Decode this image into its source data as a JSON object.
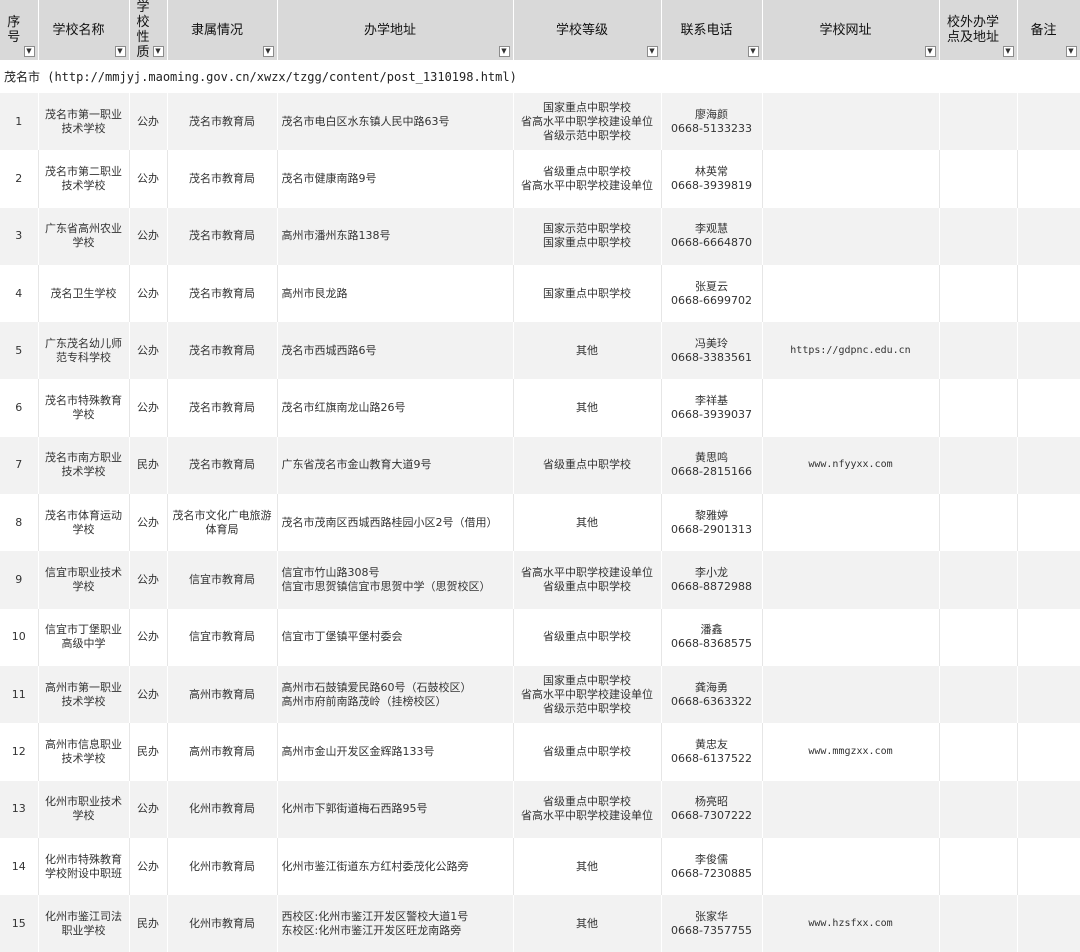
{
  "headers": {
    "no": "序号",
    "name": "学校名称",
    "nature": "学校性质",
    "affiliation": "隶属情况",
    "address": "办学地址",
    "grade": "学校等级",
    "contact": "联系电话",
    "website": "学校网址",
    "offsite": "校外办学点及地址",
    "remark": "备注",
    "dropdown_icon": "▼"
  },
  "group_title": "茂名市 (http://mmjyj.maoming.gov.cn/xwzx/tzgg/content/post_1310198.html)",
  "rows": [
    {
      "no": "1",
      "name": "茂名市第一职业技术学校",
      "nature": "公办",
      "affiliation": "茂名市教育局",
      "address": [
        "茂名市电白区水东镇人民中路63号"
      ],
      "grade": [
        "国家重点中职学校",
        "省高水平中职学校建设单位",
        "省级示范中职学校"
      ],
      "contact_name": "廖海颜",
      "contact_phone": "0668-5133233",
      "website": "",
      "offsite": "",
      "remark": ""
    },
    {
      "no": "2",
      "name": "茂名市第二职业技术学校",
      "nature": "公办",
      "affiliation": "茂名市教育局",
      "address": [
        "茂名市健康南路9号"
      ],
      "grade": [
        "省级重点中职学校",
        "省高水平中职学校建设单位"
      ],
      "contact_name": "林英常",
      "contact_phone": "0668-3939819",
      "website": "",
      "offsite": "",
      "remark": ""
    },
    {
      "no": "3",
      "name": "广东省高州农业学校",
      "nature": "公办",
      "affiliation": "茂名市教育局",
      "address": [
        "高州市潘州东路138号"
      ],
      "grade": [
        "国家示范中职学校",
        "国家重点中职学校"
      ],
      "contact_name": "李观慧",
      "contact_phone": "0668-6664870",
      "website": "",
      "offsite": "",
      "remark": ""
    },
    {
      "no": "4",
      "name": "茂名卫生学校",
      "nature": "公办",
      "affiliation": "茂名市教育局",
      "address": [
        "高州市艮龙路"
      ],
      "grade": [
        "国家重点中职学校"
      ],
      "contact_name": "张夏云",
      "contact_phone": "0668-6699702",
      "website": "",
      "offsite": "",
      "remark": ""
    },
    {
      "no": "5",
      "name": "广东茂名幼儿师范专科学校",
      "nature": "公办",
      "affiliation": "茂名市教育局",
      "address": [
        "茂名市西城西路6号"
      ],
      "grade": [
        "其他"
      ],
      "contact_name": "冯美玲",
      "contact_phone": "0668-3383561",
      "website": "https://gdpnc.edu.cn",
      "offsite": "",
      "remark": ""
    },
    {
      "no": "6",
      "name": "茂名市特殊教育学校",
      "nature": "公办",
      "affiliation": "茂名市教育局",
      "address": [
        "茂名市红旗南龙山路26号"
      ],
      "grade": [
        "其他"
      ],
      "contact_name": "李祥基",
      "contact_phone": "0668-3939037",
      "website": "",
      "offsite": "",
      "remark": ""
    },
    {
      "no": "7",
      "name": "茂名市南方职业技术学校",
      "nature": "民办",
      "affiliation": "茂名市教育局",
      "address": [
        "广东省茂名市金山教育大道9号"
      ],
      "grade": [
        "省级重点中职学校"
      ],
      "contact_name": "黄思鸣",
      "contact_phone": "0668-2815166",
      "website": "www.nfyyxx.com",
      "offsite": "",
      "remark": ""
    },
    {
      "no": "8",
      "name": "茂名市体育运动学校",
      "nature": "公办",
      "affiliation": "茂名市文化广电旅游体育局",
      "address": [
        "茂名市茂南区西城西路桂园小区2号（借用）"
      ],
      "grade": [
        "其他"
      ],
      "contact_name": "黎雅婷",
      "contact_phone": "0668-2901313",
      "website": "",
      "offsite": "",
      "remark": ""
    },
    {
      "no": "9",
      "name": "信宜市职业技术学校",
      "nature": "公办",
      "affiliation": "信宜市教育局",
      "address": [
        "信宜市竹山路308号",
        "信宜市思贺镇信宜市思贺中学（思贺校区）"
      ],
      "grade": [
        "省高水平中职学校建设单位",
        "省级重点中职学校"
      ],
      "contact_name": "李小龙",
      "contact_phone": "0668-8872988",
      "website": "",
      "offsite": "",
      "remark": ""
    },
    {
      "no": "10",
      "name": "信宜市丁堡职业高级中学",
      "nature": "公办",
      "affiliation": "信宜市教育局",
      "address": [
        "信宜市丁堡镇平堡村委会"
      ],
      "grade": [
        "省级重点中职学校"
      ],
      "contact_name": "潘鑫",
      "contact_phone": "0668-8368575",
      "website": "",
      "offsite": "",
      "remark": ""
    },
    {
      "no": "11",
      "name": "高州市第一职业技术学校",
      "nature": "公办",
      "affiliation": "高州市教育局",
      "address": [
        "高州市石鼓镇爱民路60号（石鼓校区）",
        "高州市府前南路茂岭（挂榜校区）"
      ],
      "grade": [
        "国家重点中职学校",
        "省高水平中职学校建设单位",
        "省级示范中职学校"
      ],
      "contact_name": "龚海勇",
      "contact_phone": "0668-6363322",
      "website": "",
      "offsite": "",
      "remark": ""
    },
    {
      "no": "12",
      "name": "高州市信息职业技术学校",
      "nature": "民办",
      "affiliation": "高州市教育局",
      "address": [
        "高州市金山开发区金辉路133号"
      ],
      "grade": [
        "省级重点中职学校"
      ],
      "contact_name": "黄忠友",
      "contact_phone": "0668-6137522",
      "website": "www.mmgzxx.com",
      "offsite": "",
      "remark": ""
    },
    {
      "no": "13",
      "name": "化州市职业技术学校",
      "nature": "公办",
      "affiliation": "化州市教育局",
      "address": [
        "化州市下郭街道梅石西路95号"
      ],
      "grade": [
        "省级重点中职学校",
        "省高水平中职学校建设单位"
      ],
      "contact_name": "杨亮昭",
      "contact_phone": "0668-7307222",
      "website": "",
      "offsite": "",
      "remark": ""
    },
    {
      "no": "14",
      "name": "化州市特殊教育学校附设中职班",
      "nature": "公办",
      "affiliation": "化州市教育局",
      "address": [
        "化州市鉴江街道东方红村委茂化公路旁"
      ],
      "grade": [
        "其他"
      ],
      "contact_name": "李俊儒",
      "contact_phone": "0668-7230885",
      "website": "",
      "offsite": "",
      "remark": ""
    },
    {
      "no": "15",
      "name": "化州市鉴江司法职业学校",
      "nature": "民办",
      "affiliation": "化州市教育局",
      "address": [
        "西校区:化州市鉴江开发区警校大道1号",
        "东校区:化州市鉴江开发区旺龙南路旁"
      ],
      "grade": [
        "其他"
      ],
      "contact_name": "张家华",
      "contact_phone": "0668-7357755",
      "website": "www.hzsfxx.com",
      "offsite": "",
      "remark": ""
    }
  ]
}
